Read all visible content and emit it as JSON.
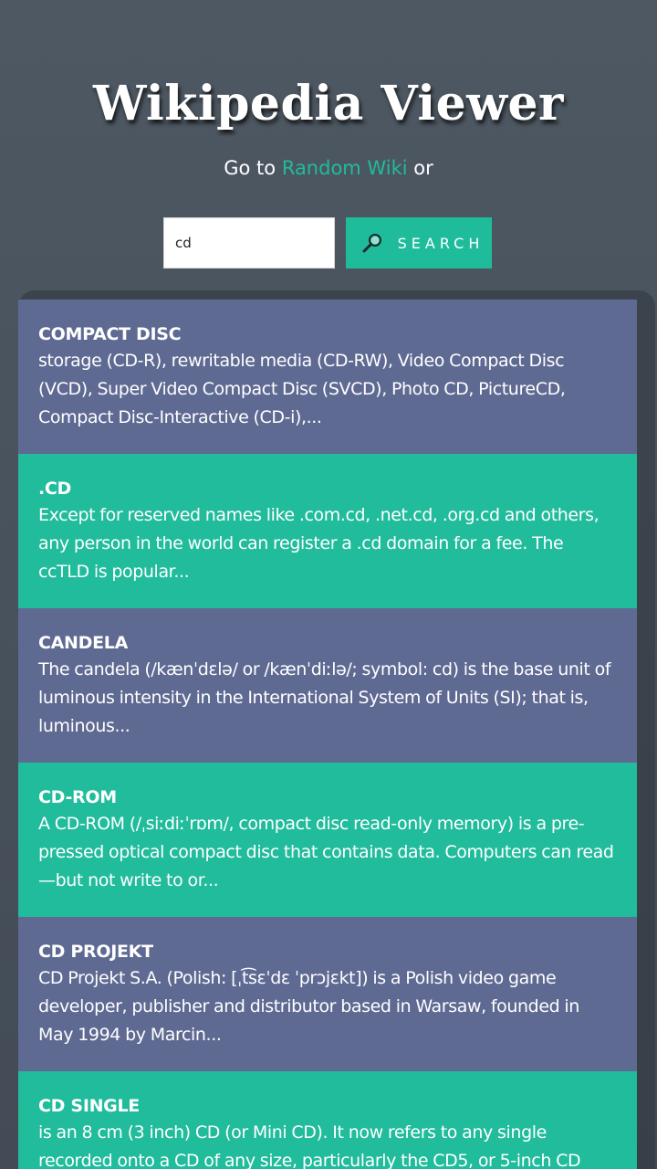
{
  "header": {
    "title": "Wikipedia Viewer"
  },
  "random": {
    "prefix": "Go to ",
    "link": "Random Wiki",
    "suffix": " or"
  },
  "search": {
    "value": "cd",
    "button_label": "SEARCH",
    "button_icon": "search-icon"
  },
  "colors": {
    "accent": "#1fbc9c",
    "card_alt": "#5f6a93",
    "background": "#48525c"
  },
  "results": [
    {
      "title": "COMPACT DISC",
      "snippet": "storage (CD-R), rewritable media (CD-RW), Video Compact Disc (VCD), Super Video Compact Disc (SVCD), Photo CD, PictureCD, Compact Disc-Interactive (CD-i),..."
    },
    {
      "title": ".CD",
      "snippet": "Except for reserved names like .com.cd, .net.cd, .org.cd and others, any person in the world can register a .cd domain for a fee. The ccTLD is popular..."
    },
    {
      "title": "CANDELA",
      "snippet": "The candela (/kænˈdɛlə/ or /kænˈdiːlə/; symbol: cd) is the base unit of luminous intensity in the International System of Units (SI); that is, luminous..."
    },
    {
      "title": "CD-ROM",
      "snippet": "A CD-ROM (/ˌsiːdiːˈrɒm/, compact disc read-only memory) is a pre-pressed optical compact disc that contains data. Computers can read—but not write to or..."
    },
    {
      "title": "CD PROJEKT",
      "snippet": "CD Projekt S.A. (Polish: [ˌt͡sɛˈdɛ ˈprɔjɛkt]) is a Polish video game developer, publisher and distributor based in Warsaw, founded in May 1994 by Marcin..."
    },
    {
      "title": "CD SINGLE",
      "snippet": "is an 8 cm (3 inch) CD (or Mini CD). It now refers to any single recorded onto a CD of any size, particularly the CD5, or 5-inch CD"
    }
  ]
}
